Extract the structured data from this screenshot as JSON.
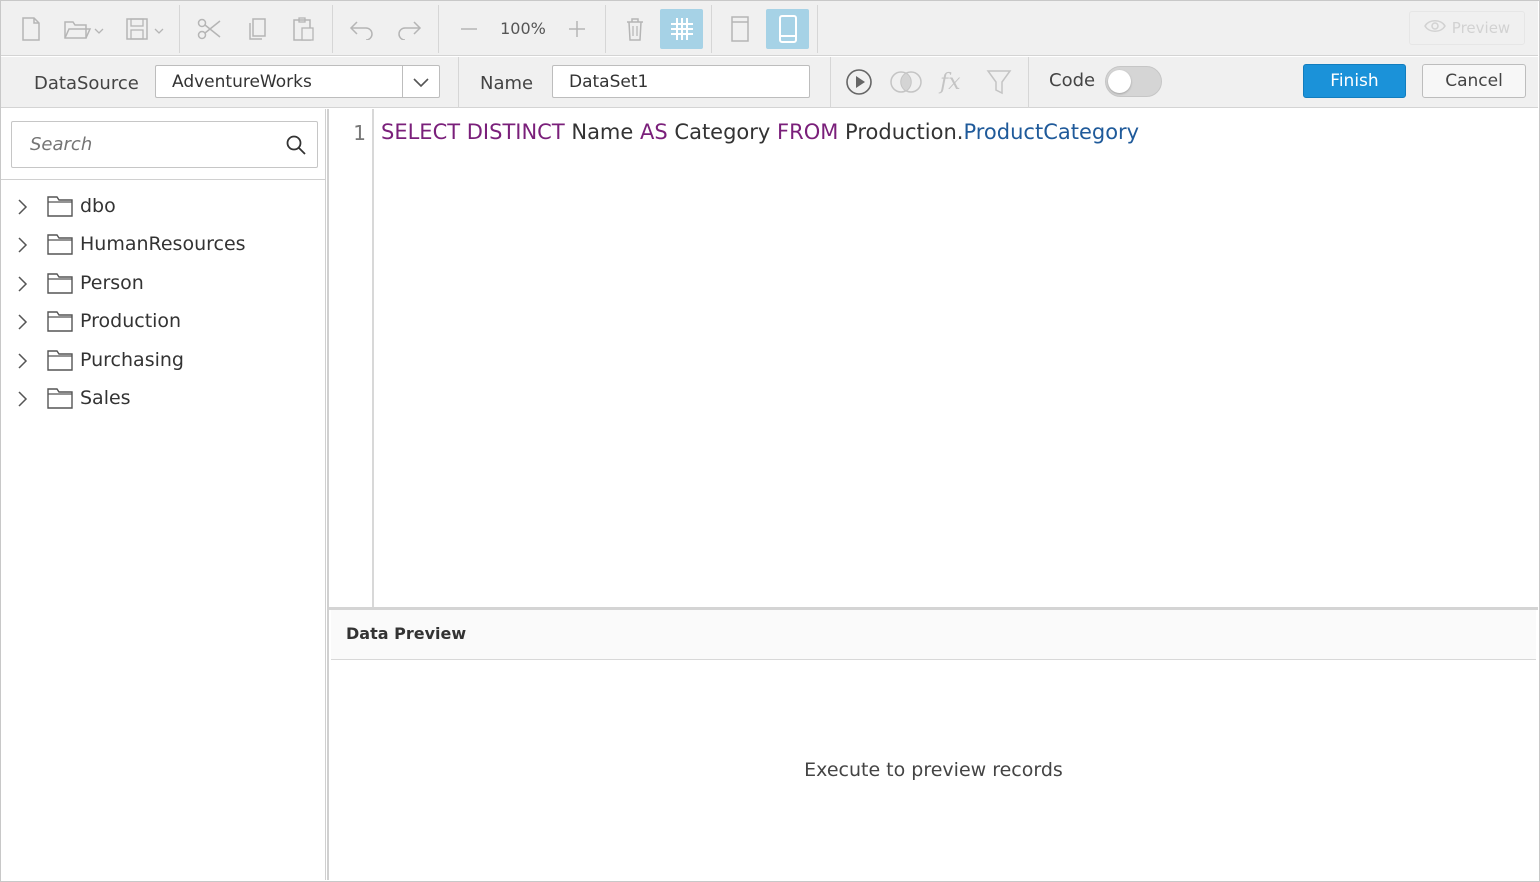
{
  "toolbar": {
    "zoom_level": "100%",
    "preview_label": "Preview",
    "icons": [
      "new-file-icon",
      "open-folder-icon",
      "save-icon",
      "cut-icon",
      "copy-icon",
      "paste-icon",
      "undo-icon",
      "redo-icon",
      "zoom-out-icon",
      "zoom-in-icon",
      "delete-icon",
      "grid-icon",
      "page-layout-icon",
      "tablet-layout-icon",
      "eye-icon"
    ]
  },
  "query_bar": {
    "datasource_label": "DataSource",
    "datasource_value": "AdventureWorks",
    "name_label": "Name",
    "name_value": "DataSet1",
    "code_label": "Code",
    "code_toggle_on": false,
    "finish_label": "Finish",
    "cancel_label": "Cancel",
    "icons": [
      "run-icon",
      "join-icon",
      "function-icon",
      "filter-icon"
    ]
  },
  "sidebar": {
    "search_placeholder": "Search",
    "items": [
      {
        "label": "dbo"
      },
      {
        "label": "HumanResources"
      },
      {
        "label": "Person"
      },
      {
        "label": "Production"
      },
      {
        "label": "Purchasing"
      },
      {
        "label": "Sales"
      }
    ]
  },
  "editor": {
    "line_number": "1",
    "tokens": {
      "select": "SELECT",
      "distinct": "DISTINCT",
      "name": "Name",
      "as": "AS",
      "category": "Category",
      "from": "FROM",
      "schema": "Production.",
      "table": "ProductCategory"
    }
  },
  "data_preview": {
    "title": "Data Preview",
    "message": "Execute to preview records"
  },
  "colors": {
    "accent": "#1b92d9",
    "keyword": "#7a1f7a",
    "object": "#1f5a9a",
    "active_toggle_bg": "#a6d2e6"
  }
}
